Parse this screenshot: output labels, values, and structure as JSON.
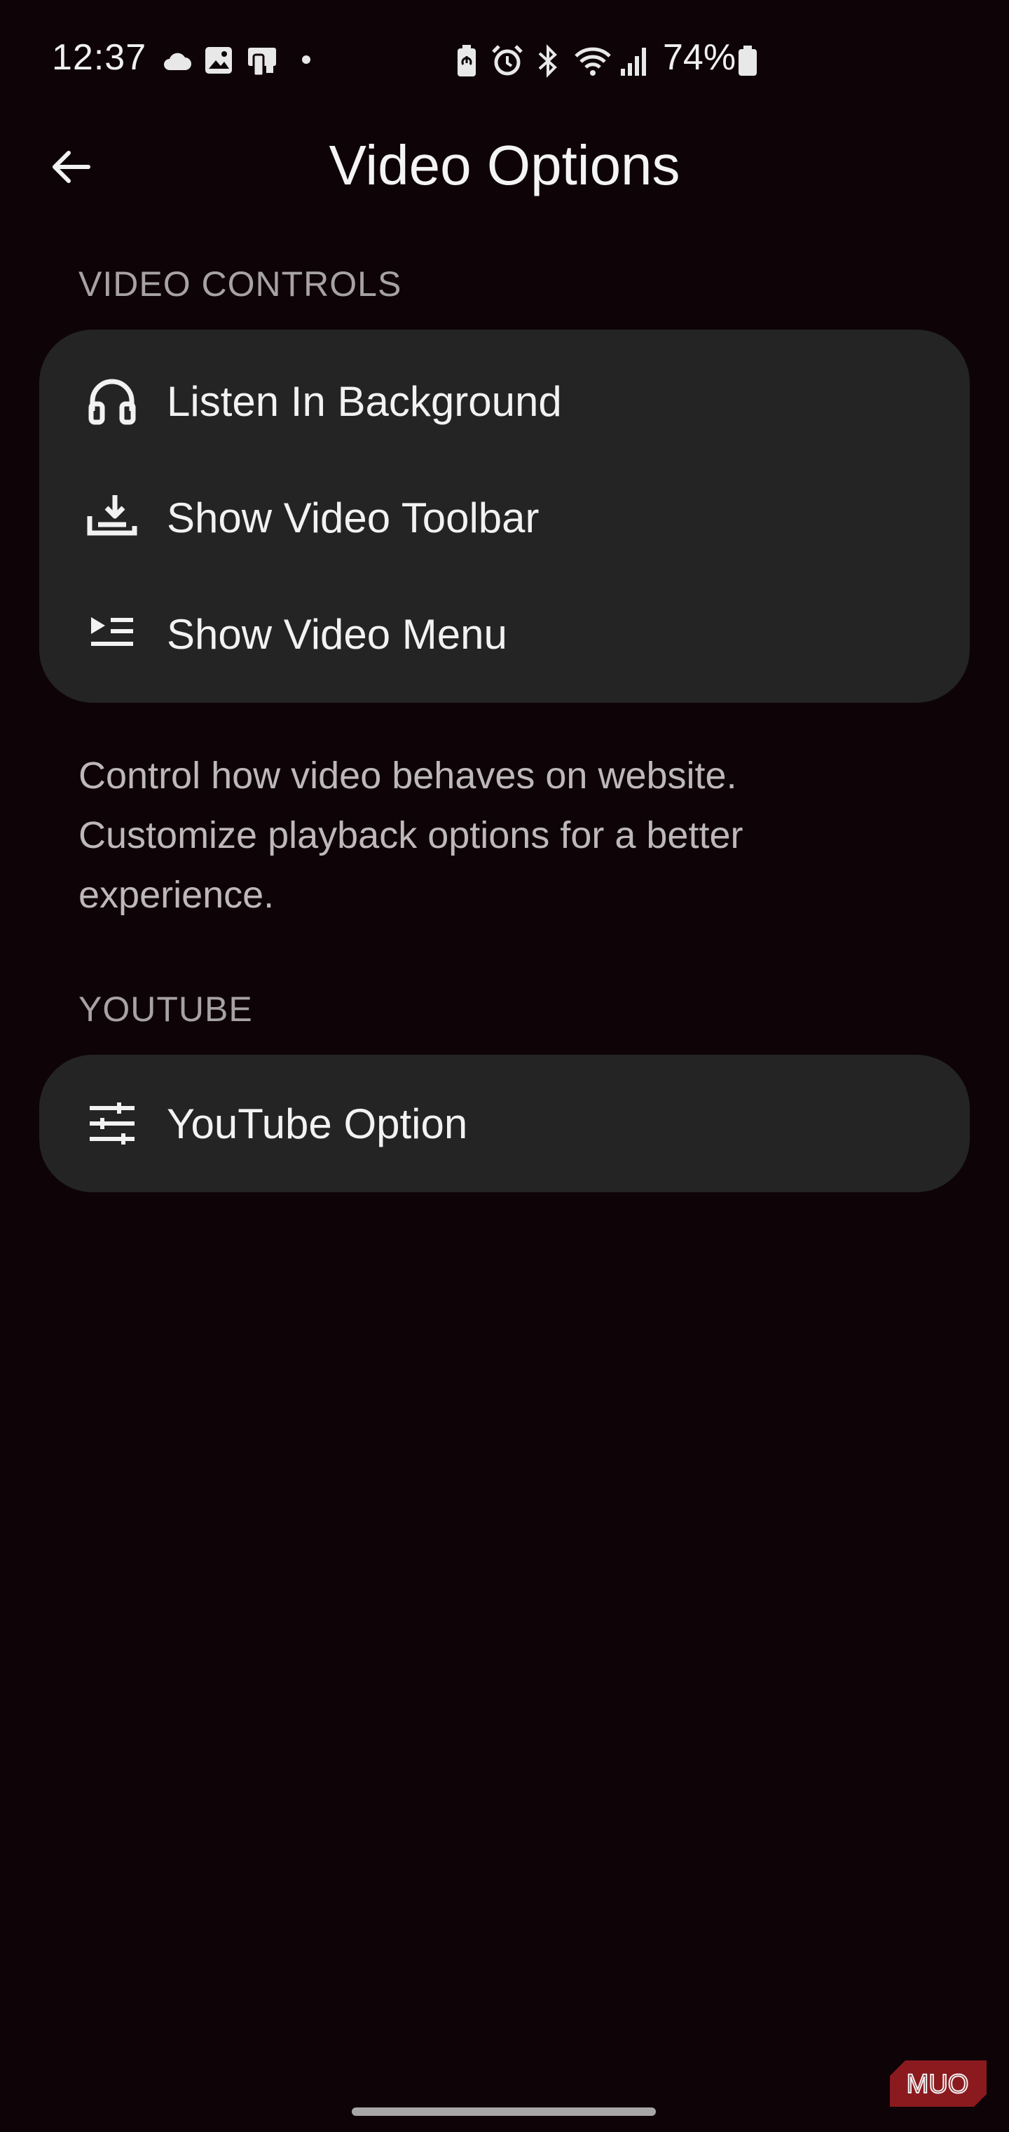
{
  "status_bar": {
    "time": "12:37",
    "battery_percent": "74%",
    "icons": [
      "cloud-icon",
      "image-icon",
      "cast-icon",
      "dot-icon",
      "battery-saver-icon",
      "alarm-icon",
      "bluetooth-icon",
      "wifi-icon",
      "signal-icon",
      "battery-icon"
    ]
  },
  "header": {
    "title": "Video Options",
    "back_icon": "arrow-left-icon"
  },
  "sections": {
    "video_controls": {
      "label": "VIDEO CONTROLS",
      "items": [
        {
          "label": "Listen In Background",
          "icon": "headphones-icon"
        },
        {
          "label": "Show Video Toolbar",
          "icon": "download-tray-icon"
        },
        {
          "label": "Show Video Menu",
          "icon": "playlist-icon"
        }
      ],
      "description": "Control how video behaves on website. Customize playback options for a better experience."
    },
    "youtube": {
      "label": "YOUTUBE",
      "items": [
        {
          "label": "YouTube Option",
          "icon": "sliders-icon"
        }
      ]
    }
  },
  "watermark": {
    "text": "MUO",
    "color": "#8b1a1f"
  },
  "colors": {
    "background": "#0e0407",
    "card": "#242424",
    "section_label": "#a7a2a4",
    "description": "#bdb8ba"
  }
}
